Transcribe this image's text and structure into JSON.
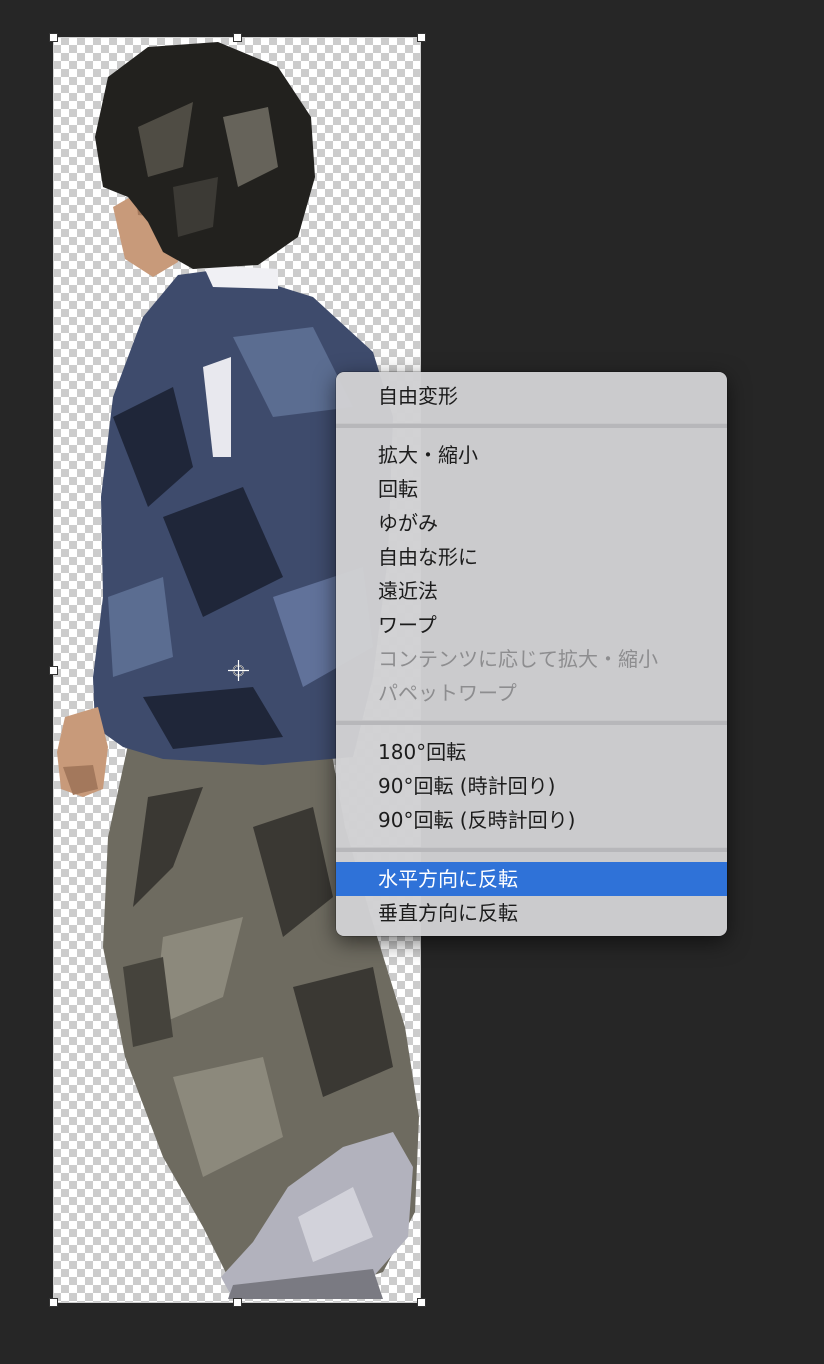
{
  "colors": {
    "workspace": "#262626",
    "menu_background": "#d1d1d3",
    "menu_highlight": "#2f72d8",
    "menu_text": "#1c1c1c",
    "menu_text_disabled": "#8d8d8f"
  },
  "canvas": {
    "layer_content": "boy-walking-cutout",
    "transparency": "checkerboard"
  },
  "context_menu": {
    "groups": [
      [
        {
          "label": "自由変形",
          "enabled": true
        }
      ],
      [
        {
          "label": "拡大・縮小",
          "enabled": true
        },
        {
          "label": "回転",
          "enabled": true
        },
        {
          "label": "ゆがみ",
          "enabled": true
        },
        {
          "label": "自由な形に",
          "enabled": true
        },
        {
          "label": "遠近法",
          "enabled": true
        },
        {
          "label": "ワープ",
          "enabled": true
        },
        {
          "label": "コンテンツに応じて拡大・縮小",
          "enabled": false
        },
        {
          "label": "パペットワープ",
          "enabled": false
        }
      ],
      [
        {
          "label": "180°回転",
          "enabled": true
        },
        {
          "label": "90°回転 (時計回り)",
          "enabled": true
        },
        {
          "label": "90°回転 (反時計回り)",
          "enabled": true
        }
      ],
      [
        {
          "label": "水平方向に反転",
          "enabled": true,
          "highlighted": true
        },
        {
          "label": "垂直方向に反転",
          "enabled": true
        }
      ]
    ]
  }
}
